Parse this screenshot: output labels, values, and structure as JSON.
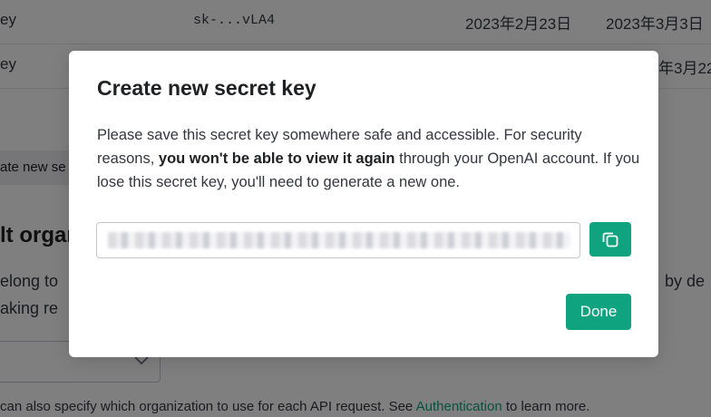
{
  "background": {
    "rows": [
      {
        "name": "ey",
        "key": "sk-...vLA4",
        "created": "2023年2月23日",
        "last_used": "2023年3月3日"
      },
      {
        "name": "ey",
        "key": "",
        "created": "",
        "last_used": "年3月22"
      }
    ],
    "create_button_label": "ate new se",
    "heading": "lt organ",
    "para_line1": "elong to",
    "para_line2": "aking re",
    "para_right": "by de",
    "footer": {
      "text": "can also specify which organization to use for each API request. See",
      "link": "Authentication",
      "suffix": "to learn more."
    }
  },
  "modal": {
    "title": "Create new secret key",
    "body_before": "Please save this secret key somewhere safe and accessible. For security reasons,",
    "body_bold": "you won't be able to view it again",
    "body_after": "through your OpenAI account. If you lose this secret key, you'll need to generate a new one.",
    "copy_icon": "copy-icon",
    "done_label": "Done"
  },
  "colors": {
    "accent": "#10a37f",
    "overlay": "rgba(0,0,0,0.5)"
  }
}
